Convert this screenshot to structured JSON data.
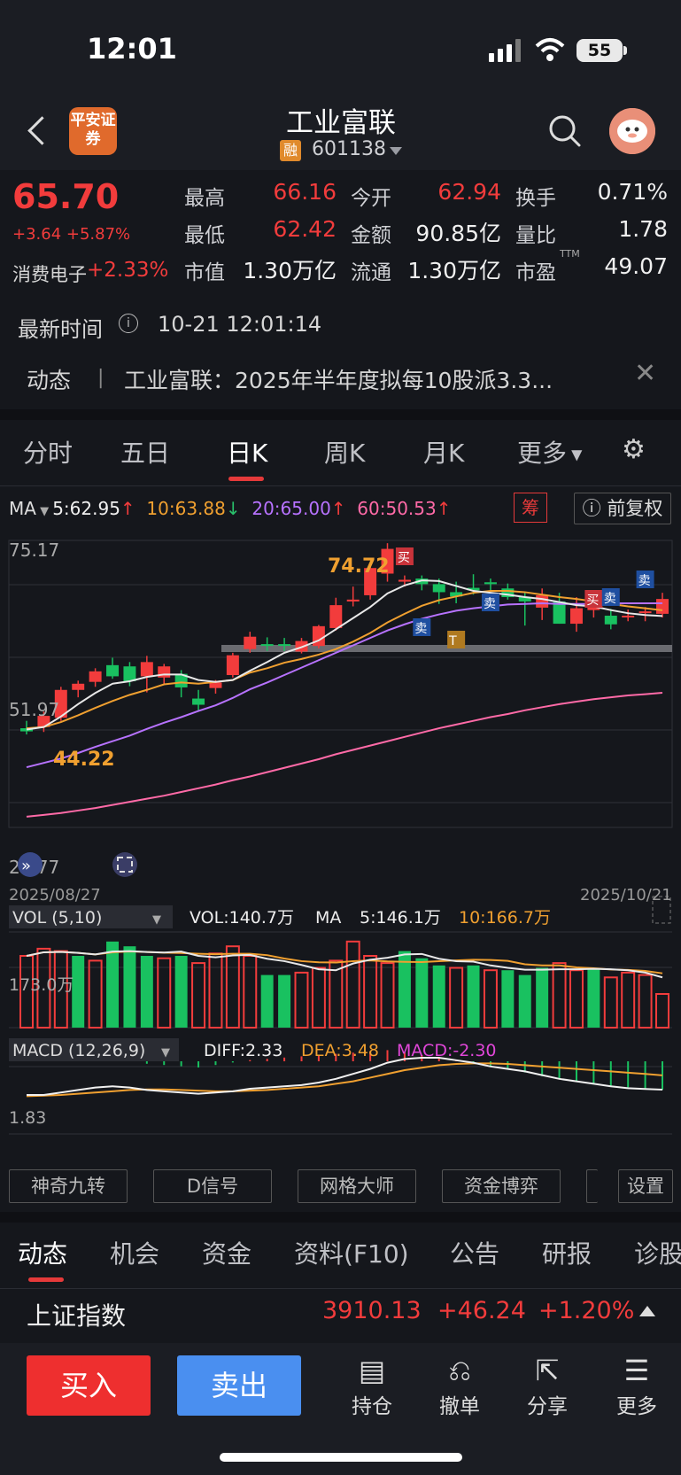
{
  "status_bar": {
    "time": "12:01",
    "battery": "55"
  },
  "header": {
    "logo_text": "平安证券",
    "stock_name": "工业富联",
    "rong_badge": "融",
    "stock_code": "601138"
  },
  "quote": {
    "price": "65.70",
    "change": "+3.64 +5.87%",
    "sector_name": "消费电子",
    "sector_change": "+2.33%",
    "fields": [
      {
        "label": "最高",
        "value": "66.16",
        "color": "red"
      },
      {
        "label": "今开",
        "value": "62.94",
        "color": "red"
      },
      {
        "label": "换手",
        "value": "0.71%",
        "color": "white"
      },
      {
        "label": "最低",
        "value": "62.42",
        "color": "red"
      },
      {
        "label": "金额",
        "value": "90.85亿",
        "color": "white"
      },
      {
        "label": "量比",
        "value": "1.78",
        "color": "white"
      },
      {
        "label": "市值",
        "value": "1.30万亿",
        "color": "white"
      },
      {
        "label": "流通",
        "value": "1.30万亿",
        "color": "white"
      },
      {
        "label": "市盈",
        "value": "49.07",
        "color": "white",
        "sup": "TTM"
      }
    ],
    "update_label": "最新时间",
    "update_time": "10-21 12:01:14"
  },
  "news": {
    "tag": "动态",
    "separator": "|",
    "text": "工业富联：2025年半年度拟每10股派3.3..."
  },
  "kline_tabs": [
    "分时",
    "五日",
    "日K",
    "周K",
    "月K",
    "更多"
  ],
  "ma_legend": {
    "label": "MA",
    "ma5": "5:62.95",
    "ma10": "10:63.88",
    "ma20": "20:65.00",
    "ma60": "60:50.53",
    "chou": "筹",
    "fuquan": "前复权"
  },
  "chart": {
    "y_top": "75.17",
    "y_mid": "51.97",
    "y_bot": "28.77",
    "high_label": "74.72",
    "low_label": "44.22",
    "date_start": "2025/08/27",
    "date_end": "2025/10/21",
    "signals": [
      "买",
      "卖",
      "卖",
      "T",
      "买",
      "卖",
      "卖"
    ]
  },
  "volume": {
    "title": "VOL (5,10)",
    "vol": "VOL:140.7万",
    "ma_label": "MA",
    "ma5": "5:146.1万",
    "ma10": "10:166.7万",
    "axis": "173.0万"
  },
  "macd": {
    "title": "MACD (12,26,9)",
    "diff": "DIFF:2.33",
    "dea": "DEA:3.48",
    "macd": "MACD:-2.30",
    "axis": "1.83"
  },
  "indicators": [
    "神奇九转",
    "D信号",
    "网格大师",
    "资金博弈",
    "设置"
  ],
  "bottom_tabs": [
    "动态",
    "机会",
    "资金",
    "资料(F10)",
    "公告",
    "研报",
    "诊股"
  ],
  "index": {
    "name": "上证指数",
    "value": "3910.13",
    "change": "+46.24",
    "pct": "+1.20%"
  },
  "actions": {
    "buy": "买入",
    "sell": "卖出",
    "items": [
      {
        "label": "持仓",
        "icon": "holdings-icon"
      },
      {
        "label": "撤单",
        "icon": "cancel-order-icon"
      },
      {
        "label": "分享",
        "icon": "share-icon"
      },
      {
        "label": "更多",
        "icon": "more-icon"
      }
    ]
  },
  "chart_data": {
    "type": "candlestick",
    "ylim": [
      28.77,
      75.17
    ],
    "x_start": "2025/08/27",
    "x_end": "2025/10/21",
    "candles": [
      {
        "o": 44.8,
        "h": 46.0,
        "l": 43.8,
        "c": 44.3
      },
      {
        "o": 45.0,
        "h": 47.5,
        "l": 44.2,
        "c": 46.8
      },
      {
        "o": 46.5,
        "h": 51.5,
        "l": 46.0,
        "c": 51.0
      },
      {
        "o": 51.0,
        "h": 52.5,
        "l": 49.8,
        "c": 52.0
      },
      {
        "o": 52.3,
        "h": 54.5,
        "l": 51.5,
        "c": 54.0
      },
      {
        "o": 55.0,
        "h": 56.2,
        "l": 52.8,
        "c": 53.2
      },
      {
        "o": 54.8,
        "h": 55.5,
        "l": 51.6,
        "c": 52.4
      },
      {
        "o": 53.2,
        "h": 56.5,
        "l": 50.6,
        "c": 55.5
      },
      {
        "o": 53.0,
        "h": 55.2,
        "l": 51.8,
        "c": 54.8
      },
      {
        "o": 53.6,
        "h": 54.2,
        "l": 49.8,
        "c": 51.4
      },
      {
        "o": 49.6,
        "h": 51.0,
        "l": 47.6,
        "c": 48.6
      },
      {
        "o": 51.3,
        "h": 52.6,
        "l": 50.4,
        "c": 52.2
      },
      {
        "o": 53.4,
        "h": 57.0,
        "l": 53.0,
        "c": 56.6
      },
      {
        "o": 57.6,
        "h": 60.4,
        "l": 57.0,
        "c": 59.6
      },
      {
        "o": 58.4,
        "h": 59.5,
        "l": 57.3,
        "c": 58.2
      },
      {
        "o": 58.4,
        "h": 59.4,
        "l": 57.3,
        "c": 58.3
      },
      {
        "o": 57.2,
        "h": 59.4,
        "l": 56.9,
        "c": 58.9
      },
      {
        "o": 58.1,
        "h": 61.5,
        "l": 57.7,
        "c": 61.3
      },
      {
        "o": 61.0,
        "h": 65.9,
        "l": 60.6,
        "c": 64.7
      },
      {
        "o": 65.3,
        "h": 67.7,
        "l": 64.5,
        "c": 65.6
      },
      {
        "o": 66.3,
        "h": 71.3,
        "l": 65.6,
        "c": 70.7
      },
      {
        "o": 69.8,
        "h": 74.72,
        "l": 68.5,
        "c": 73.8
      },
      {
        "o": 68.5,
        "h": 69.5,
        "l": 67.7,
        "c": 68.8
      },
      {
        "o": 69.0,
        "h": 69.5,
        "l": 67.1,
        "c": 68.1
      },
      {
        "o": 68.1,
        "h": 69.0,
        "l": 64.9,
        "c": 66.8
      },
      {
        "o": 66.8,
        "h": 68.5,
        "l": 65.0,
        "c": 66.1
      },
      {
        "o": 67.5,
        "h": 69.7,
        "l": 66.4,
        "c": 67.1
      },
      {
        "o": 68.4,
        "h": 69.0,
        "l": 67.1,
        "c": 68.1
      },
      {
        "o": 67.4,
        "h": 68.2,
        "l": 65.6,
        "c": 66.0
      },
      {
        "o": 66.0,
        "h": 66.7,
        "l": 61.4,
        "c": 65.3
      },
      {
        "o": 64.3,
        "h": 67.4,
        "l": 62.3,
        "c": 66.3
      },
      {
        "o": 65.3,
        "h": 66.7,
        "l": 61.7,
        "c": 61.7
      },
      {
        "o": 61.7,
        "h": 66.0,
        "l": 60.4,
        "c": 64.2
      },
      {
        "o": 63.9,
        "h": 65.3,
        "l": 62.7,
        "c": 64.3
      },
      {
        "o": 63.0,
        "h": 64.1,
        "l": 60.8,
        "c": 61.6
      },
      {
        "o": 62.8,
        "h": 64.0,
        "l": 62.1,
        "c": 63.0
      },
      {
        "o": 63.6,
        "h": 64.4,
        "l": 62.1,
        "c": 63.7
      },
      {
        "o": 63.3,
        "h": 66.7,
        "l": 62.7,
        "c": 65.7
      }
    ],
    "ma5_line": [
      44.6,
      45.0,
      46.7,
      48.7,
      50.5,
      52.0,
      52.4,
      53.1,
      53.5,
      53.5,
      52.6,
      52.3,
      52.6,
      54.1,
      55.5,
      57.0,
      57.9,
      59.0,
      60.8,
      62.6,
      64.4,
      66.6,
      67.9,
      68.7,
      68.6,
      67.8,
      67.0,
      66.7,
      66.4,
      66.0,
      65.7,
      65.2,
      64.7,
      64.5,
      63.9,
      63.4,
      63.1,
      62.95
    ],
    "ma10_line": [
      44.8,
      45.0,
      45.8,
      46.9,
      48.1,
      49.2,
      50.2,
      51.0,
      51.9,
      52.2,
      52.0,
      52.3,
      52.6,
      53.8,
      54.5,
      55.4,
      56.0,
      56.7,
      57.6,
      58.8,
      60.2,
      61.9,
      63.3,
      64.6,
      65.5,
      66.1,
      66.7,
      67.0,
      67.0,
      66.8,
      66.4,
      66.0,
      65.7,
      65.3,
      64.9,
      64.5,
      64.2,
      63.88
    ],
    "ma20_line": [
      38.5,
      39.2,
      39.9,
      40.8,
      41.8,
      42.7,
      43.6,
      44.7,
      45.7,
      46.6,
      47.6,
      48.5,
      49.7,
      51.1,
      52.2,
      53.4,
      54.6,
      55.8,
      57.0,
      58.2,
      59.4,
      60.6,
      61.6,
      62.5,
      63.2,
      63.8,
      64.2,
      64.5,
      64.8,
      64.9,
      65.0,
      64.9,
      64.9,
      64.9,
      65.0,
      65.0,
      65.0,
      65.0
    ],
    "ma60_line": [
      30.5,
      30.8,
      31.1,
      31.5,
      31.9,
      32.4,
      32.9,
      33.4,
      33.9,
      34.5,
      35.1,
      35.7,
      36.4,
      37.0,
      37.7,
      38.4,
      39.1,
      39.8,
      40.6,
      41.3,
      42.0,
      42.7,
      43.4,
      44.1,
      44.8,
      45.4,
      46.0,
      46.6,
      47.1,
      47.7,
      48.2,
      48.7,
      49.1,
      49.5,
      49.8,
      50.1,
      50.3,
      50.53
    ],
    "volumes": [
      300,
      330,
      320,
      300,
      280,
      360,
      340,
      300,
      290,
      300,
      270,
      310,
      340,
      300,
      220,
      220,
      230,
      250,
      280,
      360,
      300,
      270,
      320,
      290,
      260,
      250,
      260,
      240,
      240,
      220,
      250,
      270,
      240,
      250,
      210,
      230,
      220,
      140.7
    ],
    "volume_colors": [
      "r",
      "r",
      "r",
      "g",
      "r",
      "g",
      "g",
      "g",
      "r",
      "g",
      "r",
      "r",
      "r",
      "r",
      "g",
      "g",
      "r",
      "r",
      "r",
      "r",
      "r",
      "r",
      "g",
      "g",
      "g",
      "r",
      "g",
      "r",
      "g",
      "g",
      "g",
      "r",
      "r",
      "g",
      "r",
      "r",
      "r",
      "r"
    ],
    "macd_hist": [
      0.2,
      0.3,
      0.4,
      0.3,
      0.3,
      0.2,
      0.1,
      -0.2,
      -0.3,
      -0.4,
      -0.5,
      -0.3,
      -0.1,
      0.1,
      0.2,
      0.3,
      0.4,
      0.5,
      0.6,
      0.7,
      0.8,
      0.9,
      0.7,
      0.5,
      0.3,
      0.1,
      -0.1,
      -0.4,
      -0.6,
      -0.9,
      -1.2,
      -1.4,
      -1.6,
      -1.8,
      -2.0,
      -2.1,
      -2.2,
      -2.3
    ],
    "diff_line": [
      1.9,
      1.9,
      2.1,
      2.3,
      2.5,
      2.6,
      2.5,
      2.3,
      2.2,
      2.1,
      2.0,
      2.1,
      2.2,
      2.4,
      2.5,
      2.6,
      2.7,
      2.9,
      3.2,
      3.6,
      4.0,
      4.5,
      4.8,
      4.9,
      4.9,
      4.7,
      4.5,
      4.2,
      4.0,
      3.8,
      3.5,
      3.2,
      3.0,
      2.8,
      2.6,
      2.45,
      2.38,
      2.33
    ],
    "dea_line": [
      1.8,
      1.85,
      1.9,
      2.0,
      2.1,
      2.2,
      2.3,
      2.35,
      2.35,
      2.3,
      2.25,
      2.2,
      2.2,
      2.25,
      2.3,
      2.4,
      2.5,
      2.6,
      2.8,
      3.0,
      3.3,
      3.6,
      3.9,
      4.1,
      4.3,
      4.4,
      4.45,
      4.45,
      4.4,
      4.3,
      4.2,
      4.1,
      4.0,
      3.9,
      3.8,
      3.7,
      3.6,
      3.48
    ]
  }
}
